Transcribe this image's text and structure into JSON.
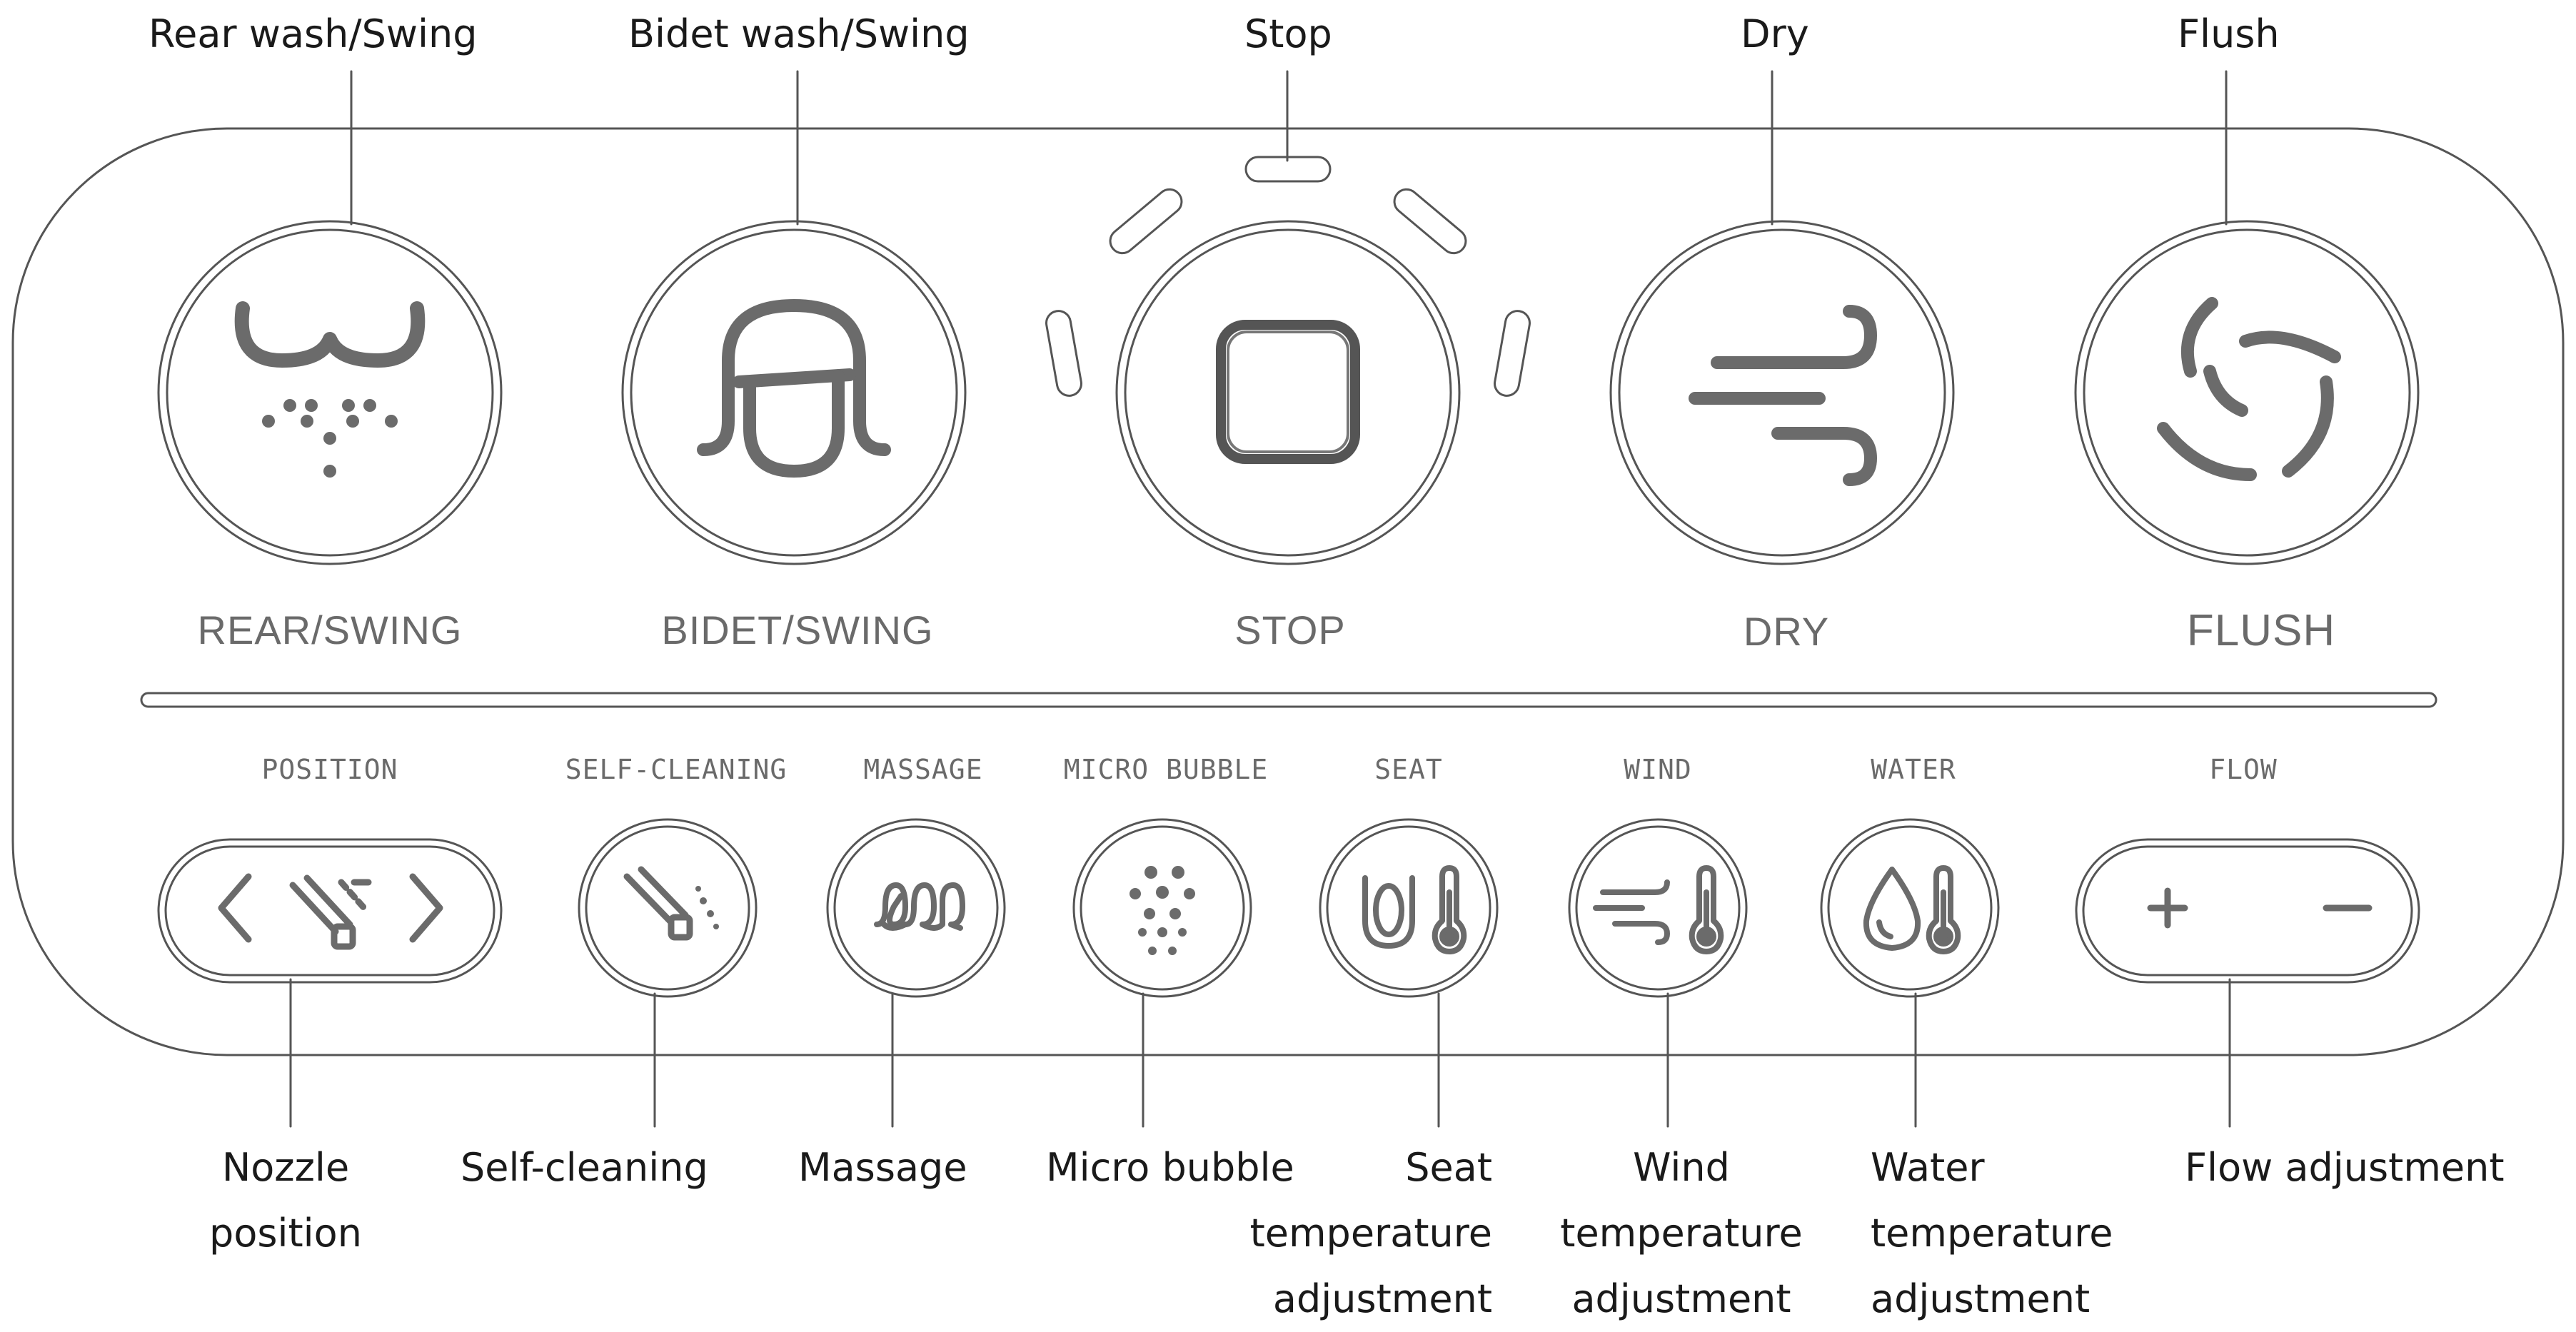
{
  "colors": {
    "outline": "#555555",
    "icon": "#6b6b6b",
    "callout_text": "#1a1a1a",
    "panel_text": "#6a6a6a"
  },
  "top_callouts": {
    "rear": "Rear wash/Swing",
    "bidet": "Bidet wash/Swing",
    "stop": "Stop",
    "dry": "Dry",
    "flush": "Flush"
  },
  "panel_labels": {
    "rear": "REAR/SWING",
    "bidet": "BIDET/SWING",
    "stop": "STOP",
    "dry": "DRY",
    "flush": "FLUSH"
  },
  "small_labels": {
    "position": "POSITION",
    "self_cleaning": "SELF-CLEANING",
    "massage": "MASSAGE",
    "micro_bubble": "MICRO BUBBLE",
    "seat": "SEAT",
    "wind": "WIND",
    "water": "WATER",
    "flow": "FLOW"
  },
  "bottom_callouts": {
    "nozzle": "Nozzle\nposition",
    "self_cleaning": "Self-cleaning",
    "massage": "Massage",
    "micro_bubble": "Micro bubble",
    "seat": "Seat\ntemperature\nadjustment",
    "wind": "Wind\ntemperature\nadjustment",
    "water": "Water\ntemperature\nadjustment",
    "flow": "Flow adjustment"
  },
  "icons": {
    "rear": "rear-wash-icon",
    "bidet": "bidet-wash-icon",
    "stop": "stop-square-icon",
    "dry": "wind-dry-icon",
    "flush": "flush-swirl-icon",
    "position": "nozzle-position-icon",
    "self_cleaning": "nozzle-clean-icon",
    "massage": "massage-coil-icon",
    "micro_bubble": "bubbles-icon",
    "seat": "seat-thermometer-icon",
    "wind": "wind-thermometer-icon",
    "water": "water-drop-thermometer-icon",
    "flow": "plus-minus-icon"
  }
}
